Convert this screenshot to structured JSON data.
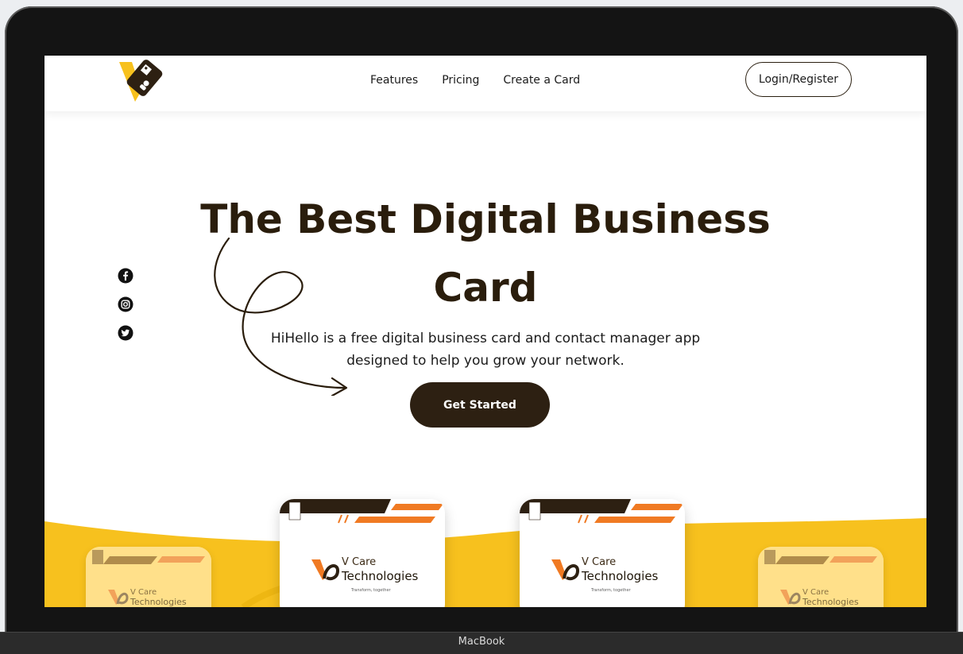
{
  "nav": {
    "links": [
      "Features",
      "Pricing",
      "Create a Card"
    ],
    "login_label": "Login/Register"
  },
  "hero": {
    "title_line1": "The Best Digital Business",
    "title_line2": "Card",
    "subtitle_line1": "HiHello is a free digital business card and contact manager app",
    "subtitle_line2": "designed to help you grow your network.",
    "cta_label": "Get Started"
  },
  "social": [
    "facebook-icon",
    "instagram-icon",
    "twitter-icon"
  ],
  "cards": {
    "brand_top": "V Care",
    "brand_main": "Technologies",
    "tagline": "Transform, together"
  },
  "device_label": "MacBook",
  "colors": {
    "accent_yellow": "#f7c11e",
    "dark_brown": "#2d2012",
    "orange": "#f07a23"
  }
}
